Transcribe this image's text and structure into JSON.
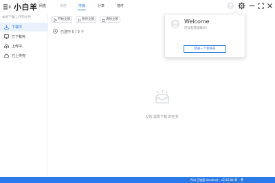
{
  "app": {
    "title": "小白羊"
  },
  "nav": {
    "tabs": [
      {
        "label": "网盘"
      },
      {
        "label": "相册"
      },
      {
        "label": "传输"
      },
      {
        "label": "分享"
      },
      {
        "label": "插件"
      }
    ],
    "active_index": 2
  },
  "top_right": {
    "icons": [
      "avatar-icon",
      "gear-icon",
      "minimize-icon",
      "maximize-icon",
      "close-icon"
    ]
  },
  "sidebar": {
    "hint": "本地下载/上传的文件",
    "items": [
      {
        "label": "下载中",
        "icon": "download-icon",
        "active": true
      },
      {
        "label": "已下载完",
        "icon": "monitor-icon",
        "active": false
      },
      {
        "label": "上传中",
        "icon": "upload-icon",
        "active": false
      },
      {
        "label": "已上传完",
        "icon": "cloud-icon",
        "active": false
      }
    ]
  },
  "toolbar": {
    "start_all": "开始全部",
    "pause_all": "暂停全部",
    "clear_all": "清除全部"
  },
  "selection": {
    "text": "已选中 0 / 0 个"
  },
  "empty": {
    "text": "没有 需要下载 的任务"
  },
  "popover": {
    "welcome": "Welcome",
    "subtitle": "还没有登录账号!",
    "login_button": "登录一个新帐号"
  },
  "status": {
    "aria": "Aria 已链接 localhost",
    "version": "v2.12.04"
  },
  "colors": {
    "accent": "#2d7be8",
    "active_bg": "#e9f1fd",
    "status_bar": "#2d7be8"
  }
}
